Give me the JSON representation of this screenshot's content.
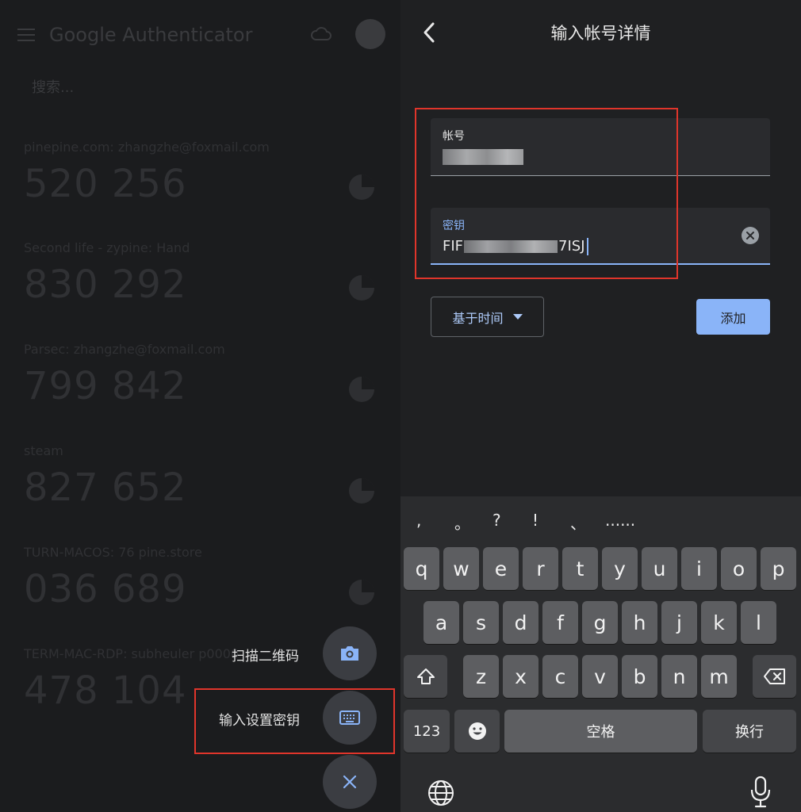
{
  "left_panel": {
    "app_title": "Google Authenticator",
    "search_placeholder": "搜索...",
    "entries": [
      {
        "label": "pinepine.com: zhangzhe@foxmail.com",
        "code": "520 256"
      },
      {
        "label": "Second life - zypine: Hand",
        "code": "830 292"
      },
      {
        "label": "Parsec: zhangzhe@foxmail.com",
        "code": "799 842"
      },
      {
        "label": "steam",
        "code": "827 652"
      },
      {
        "label": "TURN-MACOS: 76 pine.store",
        "code": "036 689"
      },
      {
        "label": "TERM-MAC-RDP: subheuler p0000",
        "code": "478 104"
      }
    ],
    "fab": {
      "scan_label": "扫描二维码",
      "enter_key_label": "输入设置密钥"
    }
  },
  "form": {
    "title": "输入帐号详情",
    "account_label": "帐号",
    "secret_label": "密钥",
    "secret_prefix": "FIF",
    "secret_suffix": "7ISJ",
    "type_select": "基于时间",
    "add_button": "添加"
  },
  "keyboard": {
    "punctuation": [
      ",",
      "。",
      "?",
      "!",
      "、",
      "......"
    ],
    "row1": [
      "q",
      "w",
      "e",
      "r",
      "t",
      "y",
      "u",
      "i",
      "o",
      "p"
    ],
    "row2": [
      "a",
      "s",
      "d",
      "f",
      "g",
      "h",
      "j",
      "k",
      "l"
    ],
    "row3": [
      "z",
      "x",
      "c",
      "v",
      "b",
      "n",
      "m"
    ],
    "num_key": "123",
    "space_key": "空格",
    "return_key": "换行"
  },
  "colors": {
    "accent": "#8ab4f8",
    "highlight_box": "#e0352b"
  }
}
